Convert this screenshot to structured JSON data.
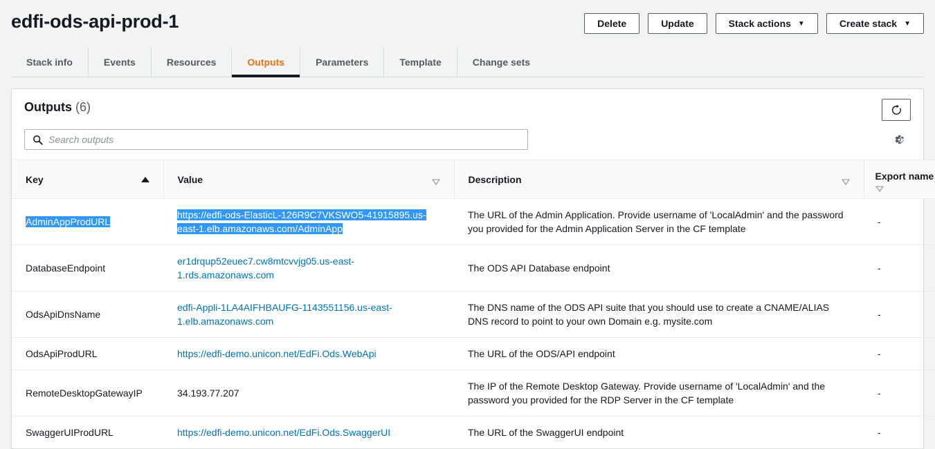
{
  "header": {
    "stack_name": "edfi-ods-api-prod-1",
    "actions": [
      {
        "label": "Delete",
        "icon": null
      },
      {
        "label": "Update",
        "icon": null
      },
      {
        "label": "Stack actions",
        "icon": "chevron-down-icon"
      },
      {
        "label": "Create stack",
        "icon": "chevron-down-icon"
      }
    ]
  },
  "tabs": [
    {
      "label": "Stack info",
      "active": false
    },
    {
      "label": "Events",
      "active": false
    },
    {
      "label": "Resources",
      "active": false
    },
    {
      "label": "Outputs",
      "active": true
    },
    {
      "label": "Parameters",
      "active": false
    },
    {
      "label": "Template",
      "active": false
    },
    {
      "label": "Change sets",
      "active": false
    }
  ],
  "panel": {
    "title": "Outputs",
    "count": "(6)",
    "refresh_icon": "refresh-icon",
    "settings_icon": "gear-icon",
    "search": {
      "placeholder": "Search outputs",
      "value": "",
      "icon": "search-icon"
    }
  },
  "table": {
    "columns": [
      {
        "label": "Key",
        "sort": "ascending"
      },
      {
        "label": "Value",
        "sort": "none"
      },
      {
        "label": "Description",
        "sort": "none"
      },
      {
        "label": "Export name",
        "sort": "none"
      }
    ],
    "rows": [
      {
        "key": "AdminAppProdURL",
        "key_selected": true,
        "value": "https://edfi-ods-ElasticL-126R9C7VKSWO5-41915895.us-east-1.elb.amazonaws.com/AdminApp",
        "value_is_link": true,
        "value_selected": true,
        "description": "The URL of the Admin Application. Provide username of 'LocalAdmin' and the password you provided for the Admin Application Server in the CF template",
        "export_name": "-"
      },
      {
        "key": "DatabaseEndpoint",
        "key_selected": false,
        "value": "er1drqup52euec7.cw8mtcvvjg05.us-east-1.rds.amazonaws.com",
        "value_is_link": true,
        "value_selected": false,
        "description": "The ODS API Database endpoint",
        "export_name": "-"
      },
      {
        "key": "OdsApiDnsName",
        "key_selected": false,
        "value": "edfi-Appli-1LA4AIFHBAUFG-1143551156.us-east-1.elb.amazonaws.com",
        "value_is_link": true,
        "value_selected": false,
        "description": "The DNS name of the ODS API suite that you should use to create a CNAME/ALIAS DNS record to point to your own Domain e.g. mysite.com",
        "export_name": "-"
      },
      {
        "key": "OdsApiProdURL",
        "key_selected": false,
        "value": "https://edfi-demo.unicon.net/EdFi.Ods.WebApi",
        "value_is_link": true,
        "value_selected": false,
        "description": "The URL of the ODS/API endpoint",
        "export_name": "-"
      },
      {
        "key": "RemoteDesktopGatewayIP",
        "key_selected": false,
        "value": "34.193.77.207",
        "value_is_link": false,
        "value_selected": false,
        "description": "The IP of the Remote Desktop Gateway. Provide username of 'LocalAdmin' and the password you provided for the RDP Server in the CF template",
        "export_name": "-"
      },
      {
        "key": "SwaggerUIProdURL",
        "key_selected": false,
        "value": "https://edfi-demo.unicon.net/EdFi.Ods.SwaggerUI",
        "value_is_link": true,
        "value_selected": false,
        "description": "The URL of the SwaggerUI endpoint",
        "export_name": "-"
      }
    ]
  },
  "colors": {
    "accent_orange": "#ec7211",
    "link_blue": "#0073bb",
    "selection_blue": "#3297fd",
    "page_bg": "#f2f3f3"
  }
}
